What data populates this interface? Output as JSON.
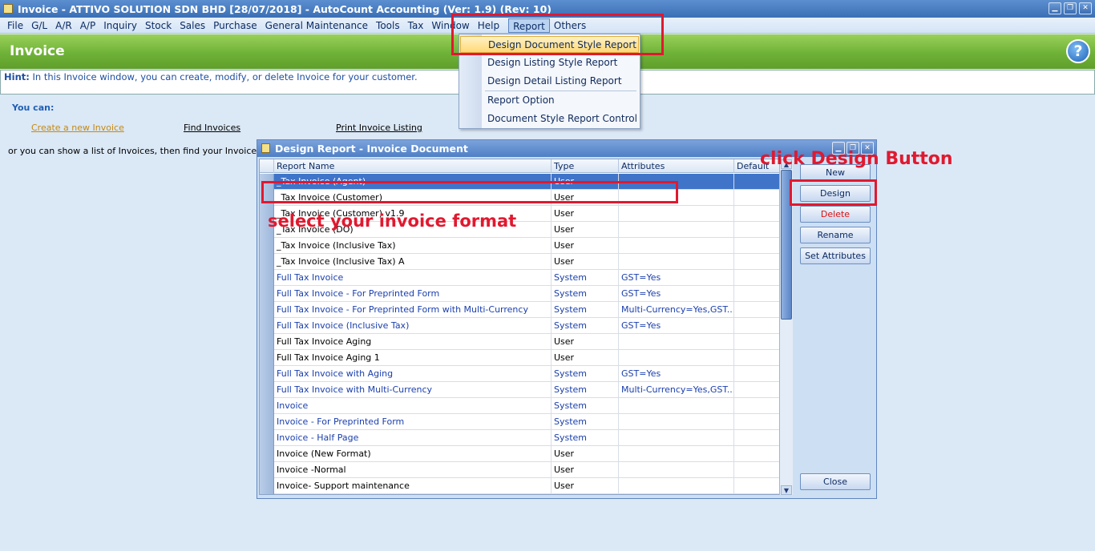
{
  "window": {
    "title": "Invoice - ATTIVO SOLUTION SDN BHD [28/07/2018] - AutoCount Accounting (Ver: 1.9) (Rev: 10)",
    "buttons": [
      "▁",
      "❐",
      "✕"
    ]
  },
  "menubar": {
    "items": [
      "File",
      "G/L",
      "A/R",
      "A/P",
      "Inquiry",
      "Stock",
      "Sales",
      "Purchase",
      "General Maintenance",
      "Tools",
      "Tax",
      "Window",
      "Help",
      "Report",
      "Others"
    ],
    "active": "Report"
  },
  "banner": {
    "title": "Invoice",
    "help": "?"
  },
  "hint": {
    "label": "Hint:",
    "text": "In this Invoice window, you can create, modify, or delete Invoice for your customer."
  },
  "main": {
    "you_can": "You can:",
    "links": [
      "Create a new Invoice",
      "Find Invoices",
      "Print Invoice Listing"
    ],
    "or_show": "or you can show a list of Invoices, then find your Invoice and ap"
  },
  "report_menu": {
    "items": [
      "Design Document Style Report",
      "Design Listing Style Report",
      "Design Detail Listing Report",
      "Report Option",
      "Document Style Report Control"
    ],
    "highlighted": "Design Document Style Report"
  },
  "dialog": {
    "title": "Design Report - Invoice Document",
    "columns": [
      "Report Name",
      "Type",
      "Attributes",
      "Default"
    ],
    "rows": [
      {
        "name": "_Tax Invoice (Agent)",
        "type": "User",
        "attr": ""
      },
      {
        "name": "_Tax Invoice (Customer)",
        "type": "User",
        "attr": ""
      },
      {
        "name": "_Tax Invoice (Customer) v1.9",
        "type": "User",
        "attr": ""
      },
      {
        "name": "_Tax Invoice (DO)",
        "type": "User",
        "attr": ""
      },
      {
        "name": "_Tax Invoice (Inclusive Tax)",
        "type": "User",
        "attr": ""
      },
      {
        "name": "_Tax Invoice (Inclusive Tax) A",
        "type": "User",
        "attr": ""
      },
      {
        "name": "Full Tax Invoice",
        "type": "System",
        "attr": "GST=Yes"
      },
      {
        "name": "Full Tax Invoice - For Preprinted Form",
        "type": "System",
        "attr": "GST=Yes"
      },
      {
        "name": "Full Tax Invoice - For Preprinted Form with Multi-Currency",
        "type": "System",
        "attr": "Multi-Currency=Yes,GST..."
      },
      {
        "name": "Full Tax Invoice (Inclusive Tax)",
        "type": "System",
        "attr": "GST=Yes"
      },
      {
        "name": "Full Tax Invoice Aging",
        "type": "User",
        "attr": ""
      },
      {
        "name": "Full Tax Invoice Aging 1",
        "type": "User",
        "attr": ""
      },
      {
        "name": "Full Tax Invoice with Aging",
        "type": "System",
        "attr": "GST=Yes"
      },
      {
        "name": "Full Tax Invoice with Multi-Currency",
        "type": "System",
        "attr": "Multi-Currency=Yes,GST..."
      },
      {
        "name": "Invoice",
        "type": "System",
        "attr": ""
      },
      {
        "name": "Invoice - For Preprinted Form",
        "type": "System",
        "attr": ""
      },
      {
        "name": "Invoice - Half Page",
        "type": "System",
        "attr": ""
      },
      {
        "name": "Invoice (New Format)",
        "type": "User",
        "attr": ""
      },
      {
        "name": "Invoice -Normal",
        "type": "User",
        "attr": ""
      },
      {
        "name": "Invoice- Support maintenance",
        "type": "User",
        "attr": ""
      }
    ],
    "selected_row": "_Tax Invoice (Agent)",
    "side_buttons": {
      "new": "New",
      "design": "Design",
      "delete": "Delete",
      "rename": "Rename",
      "set_attributes": "Set Attributes",
      "close": "Close"
    }
  },
  "annotations": {
    "select_format": "select your invoice format",
    "click_design": "click Design Button",
    "color": "#e0192f"
  }
}
